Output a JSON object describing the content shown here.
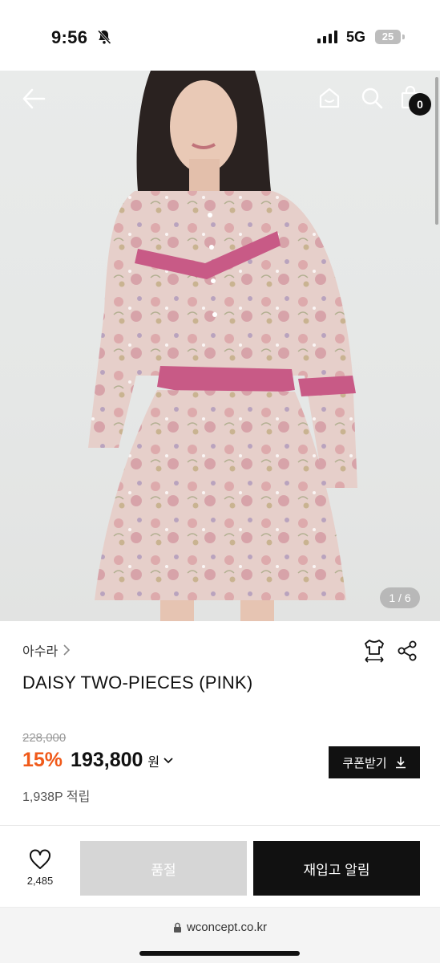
{
  "status_bar": {
    "time": "9:56",
    "network": "5G",
    "battery": "25"
  },
  "header": {
    "cart_count": "0"
  },
  "gallery": {
    "page_indicator": "1 / 6"
  },
  "product": {
    "brand": "아수라",
    "name": "DAISY TWO-PIECES (PINK)",
    "original_price": "228,000",
    "discount": "15%",
    "price": "193,800",
    "currency": "원",
    "points": "1,938P 적립",
    "coupon_label": "쿠폰받기"
  },
  "actions": {
    "like_count": "2,485",
    "soldout_label": "품절",
    "restock_label": "재입고 알림"
  },
  "browser": {
    "url": "wconcept.co.kr"
  },
  "colors": {
    "accent_discount": "#f05a1a",
    "dark": "#111111",
    "disabled": "#d6d6d6"
  }
}
